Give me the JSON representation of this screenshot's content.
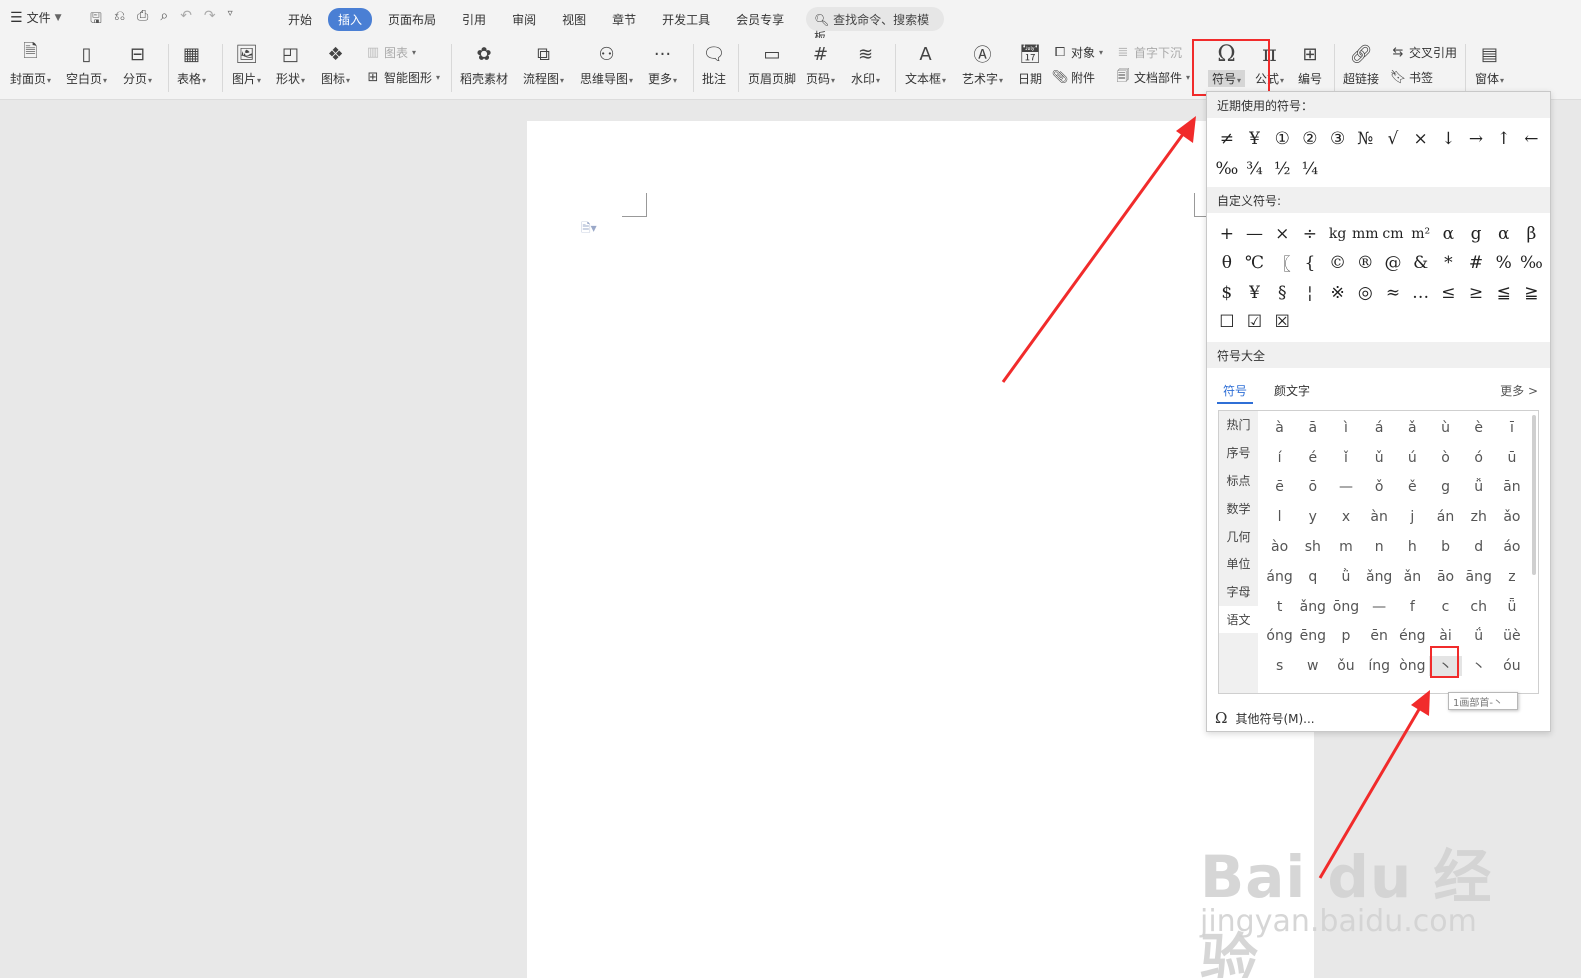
{
  "menubar": {
    "file_label": "文件",
    "tabs": [
      {
        "label": "开始",
        "active": false
      },
      {
        "label": "插入",
        "active": true
      },
      {
        "label": "页面布局",
        "active": false
      },
      {
        "label": "引用",
        "active": false
      },
      {
        "label": "审阅",
        "active": false
      },
      {
        "label": "视图",
        "active": false
      },
      {
        "label": "章节",
        "active": false
      },
      {
        "label": "开发工具",
        "active": false
      },
      {
        "label": "会员专享",
        "active": false
      }
    ],
    "search_label": "查找命令、搜索模板"
  },
  "ribbon": {
    "cover": "封面页",
    "blank": "空白页",
    "pagebreak": "分页",
    "table": "表格",
    "picture": "图片",
    "shape": "形状",
    "iconlib": "图标",
    "chart": "图表",
    "smartart": "智能图形",
    "material": "稻壳素材",
    "flowchart": "流程图",
    "mindmap": "思维导图",
    "more": "更多",
    "comment": "批注",
    "headerfooter": "页眉页脚",
    "pagenum": "页码",
    "watermark": "水印",
    "textbox": "文本框",
    "wordart": "艺术字",
    "date": "日期",
    "object": "对象",
    "attachment": "附件",
    "dropcap": "首字下沉",
    "docpart": "文档部件",
    "symbol": "符号",
    "formula": "公式",
    "numbering": "编号",
    "hyperlink": "超链接",
    "crossref": "交叉引用",
    "bookmark": "书签",
    "window": "窗体"
  },
  "symbol_panel": {
    "recent_title": "近期使用的符号：",
    "recent_row1": [
      "≠",
      "¥",
      "①",
      "②",
      "③",
      "№",
      "√",
      "×",
      "↓",
      "→",
      "↑",
      "←"
    ],
    "recent_row2": [
      "‰",
      "¾",
      "½",
      "¼"
    ],
    "custom_title": "自定义符号:",
    "custom_rows": [
      [
        "+",
        "—",
        "×",
        "÷",
        "kg",
        "mm",
        "cm",
        "m²",
        "α",
        "g",
        "α",
        "β"
      ],
      [
        "θ",
        "℃",
        "〖",
        "{",
        "©",
        "®",
        "@",
        "&",
        "*",
        "#",
        "%",
        "‰"
      ],
      [
        "$",
        "¥",
        "§",
        "¦",
        "※",
        "◎",
        "≈",
        "…",
        "≤",
        "≥",
        "≦",
        "≧"
      ],
      [
        "☐",
        "☑",
        "☒"
      ]
    ],
    "all_title": "符号大全",
    "subtab_symbol": "符号",
    "subtab_emoticon": "颜文字",
    "more_label": "更多 >",
    "categories": [
      "热门",
      "序号",
      "标点",
      "数学",
      "几何",
      "单位",
      "字母",
      "语文"
    ],
    "active_category": "语文",
    "pinyin_rows": [
      [
        "à",
        "ā",
        "ì",
        "á",
        "ǎ",
        "ù",
        "è",
        "ī"
      ],
      [
        "í",
        "é",
        "ǐ",
        "ǔ",
        "ú",
        "ò",
        "ó",
        "ū"
      ],
      [
        "ē",
        "ō",
        "—",
        "ǒ",
        "ě",
        "g",
        "ǚ",
        "ān"
      ],
      [
        "l",
        "y",
        "x",
        "àn",
        "j",
        "án",
        "zh",
        "ǎo"
      ],
      [
        "ào",
        "sh",
        "m",
        "n",
        "h",
        "b",
        "d",
        "áo"
      ],
      [
        "áng",
        "q",
        "ǜ",
        "ǎng",
        "ǎn",
        "āo",
        "āng",
        "z"
      ],
      [
        "t",
        "ǎng",
        "ōng",
        "—",
        "f",
        "c",
        "ch",
        "ǖ"
      ],
      [
        "óng",
        "ēng",
        "p",
        "ēn",
        "éng",
        "ài",
        "ǘ",
        "üè"
      ],
      [
        "s",
        "w",
        "ǒu",
        "íng",
        "òng",
        "丶",
        "丶",
        "óu"
      ]
    ],
    "tooltip": "1画部首-丶",
    "footer_label": "其他符号(M)..."
  },
  "watermark": {
    "brand": "Bai du 经验",
    "url": "jingyan.baidu.com"
  }
}
